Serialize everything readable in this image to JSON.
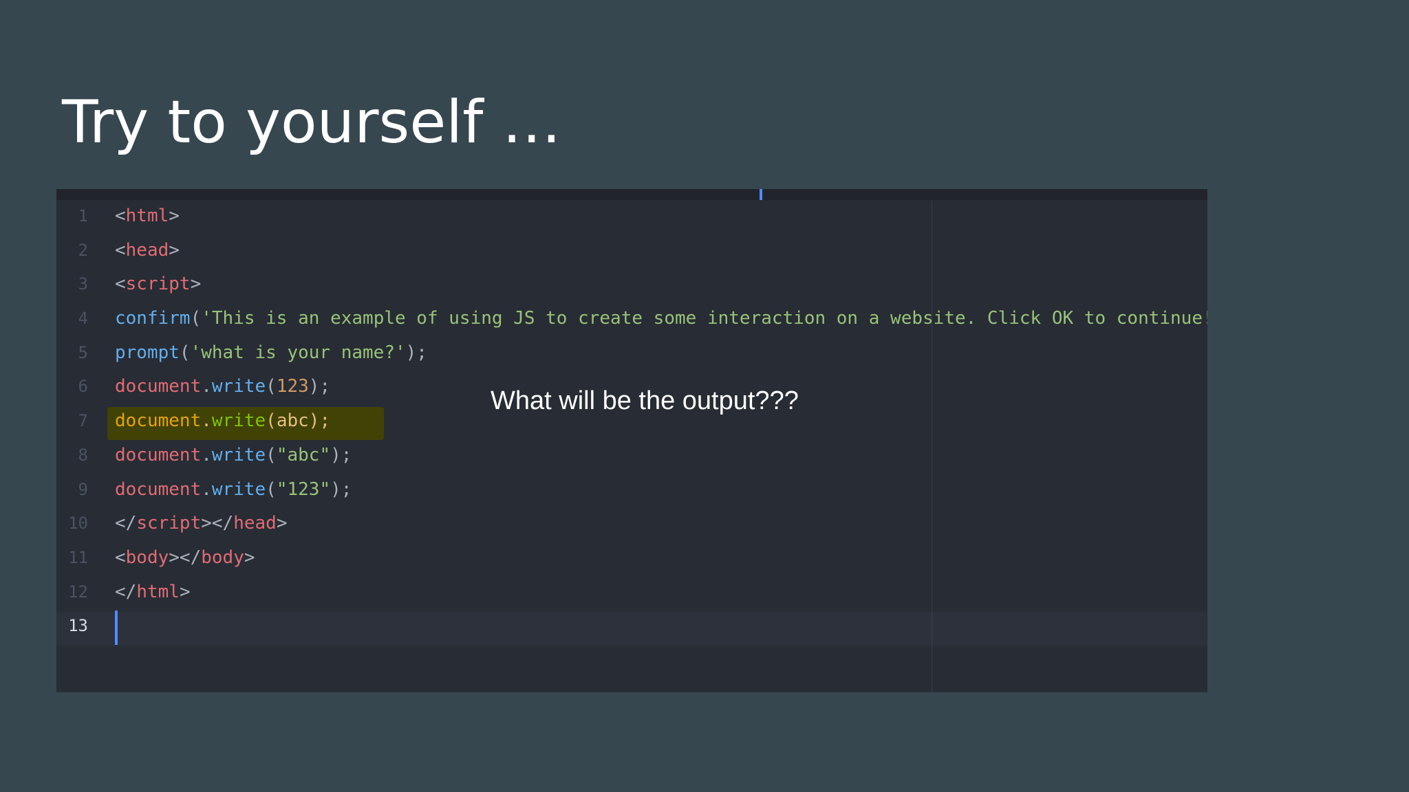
{
  "slide": {
    "title": "Try to yourself …",
    "question": "What will be the output???"
  },
  "editor": {
    "cursor_line": 13,
    "highlighted_line": 7,
    "colors": {
      "background": "#282c34",
      "tag": "#e06c75",
      "function": "#61afef",
      "string": "#98c379",
      "number": "#d19a66",
      "cursor": "#528bff",
      "selection_highlight": "#414206"
    },
    "lines": [
      {
        "number": "1",
        "tokens": [
          {
            "text": "<",
            "kind": "punct"
          },
          {
            "text": "html",
            "kind": "tag"
          },
          {
            "text": ">",
            "kind": "punct"
          }
        ]
      },
      {
        "number": "2",
        "tokens": [
          {
            "text": "<",
            "kind": "punct"
          },
          {
            "text": "head",
            "kind": "tag"
          },
          {
            "text": ">",
            "kind": "punct"
          }
        ]
      },
      {
        "number": "3",
        "tokens": [
          {
            "text": "<",
            "kind": "punct"
          },
          {
            "text": "script",
            "kind": "tag"
          },
          {
            "text": ">",
            "kind": "punct"
          }
        ]
      },
      {
        "number": "4",
        "tokens": [
          {
            "text": "confirm",
            "kind": "fn"
          },
          {
            "text": "(",
            "kind": "punct"
          },
          {
            "text": "'This is an example of using JS to create some interaction on a website. Click OK to continue!'",
            "kind": "str"
          },
          {
            "text": ");",
            "kind": "punct"
          }
        ]
      },
      {
        "number": "5",
        "tokens": [
          {
            "text": "prompt",
            "kind": "fn"
          },
          {
            "text": "(",
            "kind": "punct"
          },
          {
            "text": "'what is your name?'",
            "kind": "str"
          },
          {
            "text": ");",
            "kind": "punct"
          }
        ]
      },
      {
        "number": "6",
        "tokens": [
          {
            "text": "document",
            "kind": "obj"
          },
          {
            "text": ".",
            "kind": "punct"
          },
          {
            "text": "write",
            "kind": "fn"
          },
          {
            "text": "(",
            "kind": "punct"
          },
          {
            "text": "123",
            "kind": "num"
          },
          {
            "text": ");",
            "kind": "punct"
          }
        ]
      },
      {
        "number": "7",
        "tokens": [
          {
            "text": "document",
            "kind": "hl-obj"
          },
          {
            "text": ".",
            "kind": "hl-punct"
          },
          {
            "text": "write",
            "kind": "hl-call"
          },
          {
            "text": "(abc);",
            "kind": "hl-punct"
          }
        ]
      },
      {
        "number": "8",
        "tokens": [
          {
            "text": "document",
            "kind": "obj"
          },
          {
            "text": ".",
            "kind": "punct"
          },
          {
            "text": "write",
            "kind": "fn"
          },
          {
            "text": "(",
            "kind": "punct"
          },
          {
            "text": "\"abc\"",
            "kind": "str"
          },
          {
            "text": ");",
            "kind": "punct"
          }
        ]
      },
      {
        "number": "9",
        "tokens": [
          {
            "text": "document",
            "kind": "obj"
          },
          {
            "text": ".",
            "kind": "punct"
          },
          {
            "text": "write",
            "kind": "fn"
          },
          {
            "text": "(",
            "kind": "punct"
          },
          {
            "text": "\"123\"",
            "kind": "str"
          },
          {
            "text": ");",
            "kind": "punct"
          }
        ]
      },
      {
        "number": "10",
        "tokens": [
          {
            "text": "</",
            "kind": "punct"
          },
          {
            "text": "script",
            "kind": "tag"
          },
          {
            "text": "></",
            "kind": "punct"
          },
          {
            "text": "head",
            "kind": "tag"
          },
          {
            "text": ">",
            "kind": "punct"
          }
        ]
      },
      {
        "number": "11",
        "tokens": [
          {
            "text": "<",
            "kind": "punct"
          },
          {
            "text": "body",
            "kind": "tag"
          },
          {
            "text": "></",
            "kind": "punct"
          },
          {
            "text": "body",
            "kind": "tag"
          },
          {
            "text": ">",
            "kind": "punct"
          }
        ]
      },
      {
        "number": "12",
        "tokens": [
          {
            "text": "</",
            "kind": "punct"
          },
          {
            "text": "html",
            "kind": "tag"
          },
          {
            "text": ">",
            "kind": "punct"
          }
        ]
      },
      {
        "number": "13",
        "tokens": []
      }
    ]
  }
}
